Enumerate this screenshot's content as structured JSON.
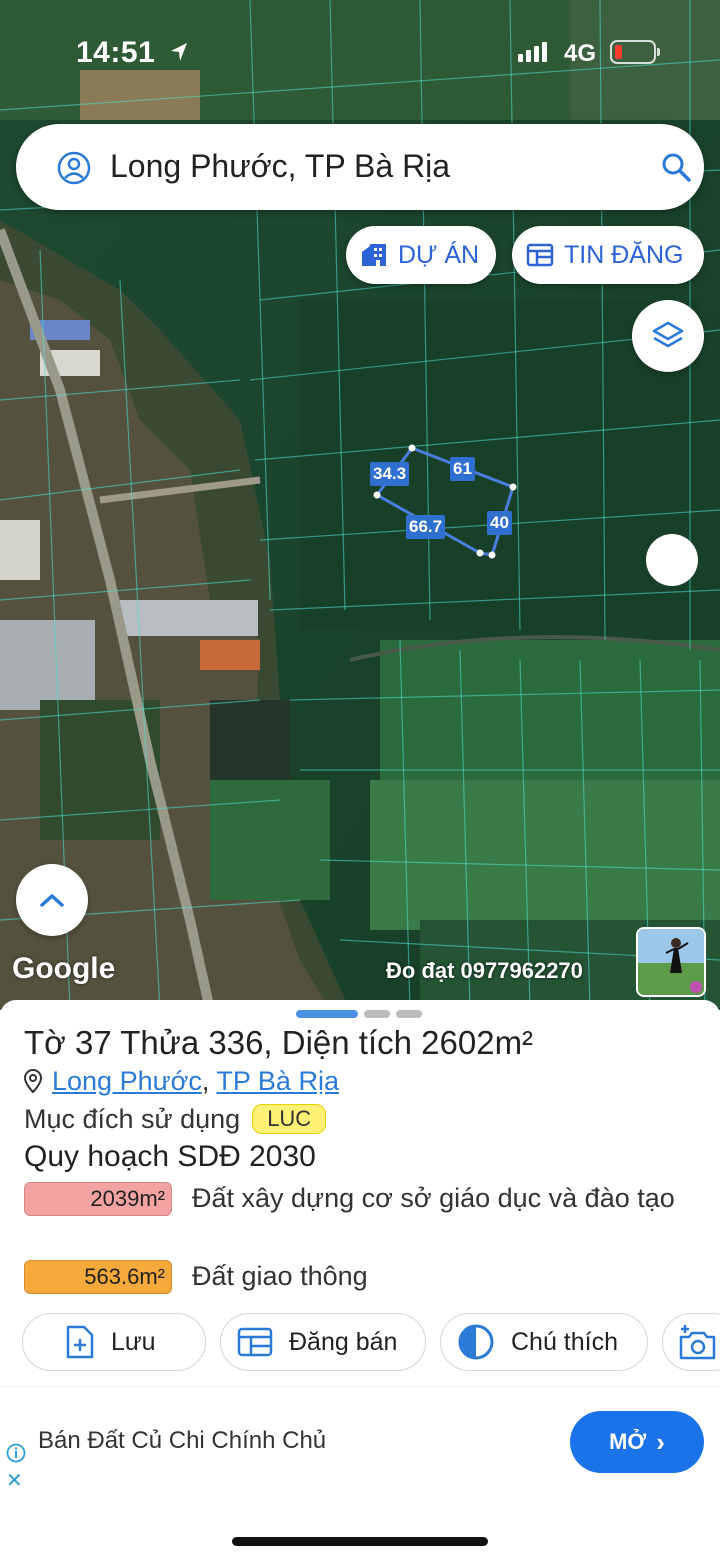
{
  "status_bar": {
    "time": "14:51",
    "network": "4G"
  },
  "search": {
    "query": "Long Phước, TP Bà Rịa"
  },
  "map_chips": {
    "du_an": "DỰ ÁN",
    "tin_dang": "TIN ĐĂNG"
  },
  "parcel_dimensions": {
    "d1": "34.3",
    "d2": "61",
    "d3": "66.7",
    "d4": "40"
  },
  "map_labels": {
    "google": "Google",
    "watermark": "Đo đạt 0977962270"
  },
  "parcel": {
    "title": "Tờ 37 Thửa 336, Diện tích 2602m²",
    "ward": "Long Phước",
    "separator": ",",
    "city": "TP Bà Rịa",
    "purpose_label": "Mục đích sử dụng",
    "purpose_code": "LUC",
    "plan_title": "Quy hoạch SDĐ 2030",
    "zones": [
      {
        "area": "2039m²",
        "label": "Đất xây dựng cơ sở giáo dục và đào tạo",
        "color": "#f4a3a3"
      },
      {
        "area": "563.6m²",
        "label": "Đất giao thông",
        "color": "#f7a93b"
      }
    ]
  },
  "actions": {
    "save": "Lưu",
    "sell": "Đăng bán",
    "legend": "Chú thích"
  },
  "ad": {
    "title": "Bán Đất Củ Chi Chính Chủ",
    "open": "MỞ"
  },
  "colors": {
    "accent": "#1a73e8",
    "parcel_outline": "#4a7fe0",
    "map_field": "#1f4a2e"
  }
}
